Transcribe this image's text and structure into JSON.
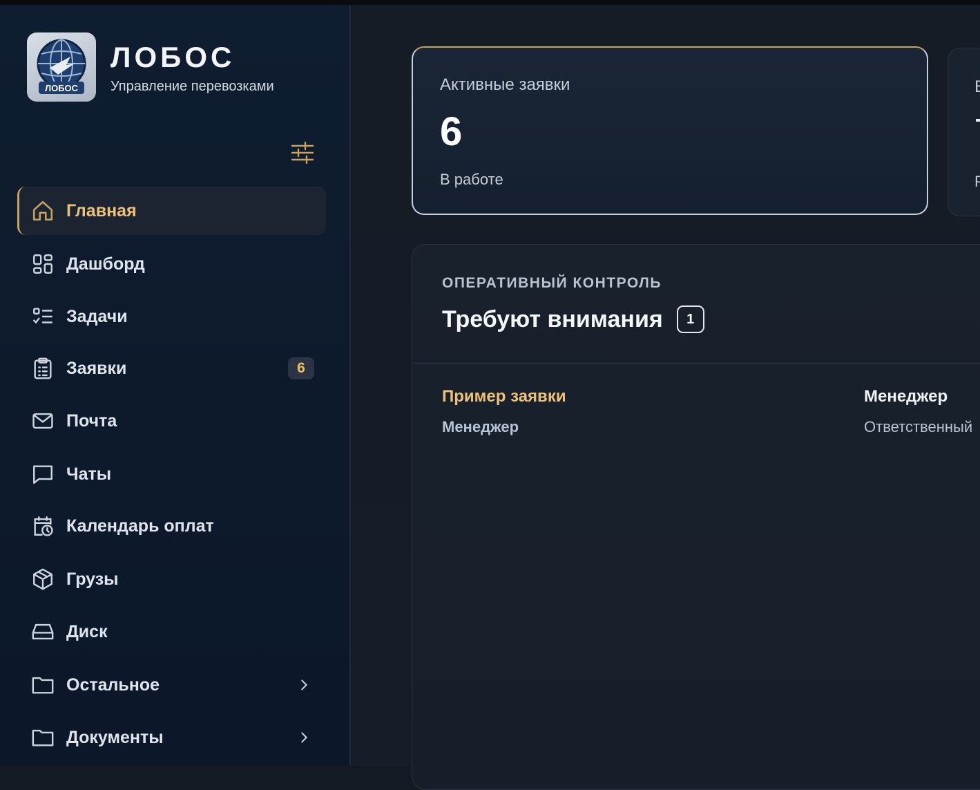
{
  "brand": {
    "title": "ЛОБОС",
    "subtitle": "Управление перевозками",
    "logo_text": "ЛОБОС"
  },
  "sidebar": {
    "settings_icon": "sliders-icon",
    "items": [
      {
        "label": "Главная",
        "icon": "home-icon",
        "active": true
      },
      {
        "label": "Дашборд",
        "icon": "dashboard-grid-icon"
      },
      {
        "label": "Задачи",
        "icon": "task-list-icon"
      },
      {
        "label": "Заявки",
        "icon": "clipboard-icon",
        "badge": "6"
      },
      {
        "label": "Почта",
        "icon": "mail-icon"
      },
      {
        "label": "Чаты",
        "icon": "chat-icon"
      },
      {
        "label": "Календарь оплат",
        "icon": "calendar-clock-icon"
      },
      {
        "label": "Грузы",
        "icon": "package-icon"
      },
      {
        "label": "Диск",
        "icon": "hard-drive-icon"
      },
      {
        "label": "Остальное",
        "icon": "folder-icon",
        "expandable": true
      },
      {
        "label": "Документы",
        "icon": "folder-icon",
        "expandable": true
      }
    ]
  },
  "stats": {
    "active": {
      "title": "Активные заявки",
      "value": "6",
      "subtitle": "В работе"
    },
    "next_peek": {
      "title_char": "В",
      "subtitle_char": "Р"
    }
  },
  "attention": {
    "eyebrow": "ОПЕРАТИВНЫЙ КОНТРОЛЬ",
    "heading": "Требуют внимания",
    "count": "1",
    "rows": [
      {
        "title": "Пример заявки",
        "subtitle": "Менеджер",
        "col_head": "Менеджер",
        "col_sub": "Ответственный"
      }
    ]
  },
  "colors": {
    "accent": "#ecc27a",
    "sidebar_bg": "#0f1d30",
    "main_bg": "#161c26"
  }
}
